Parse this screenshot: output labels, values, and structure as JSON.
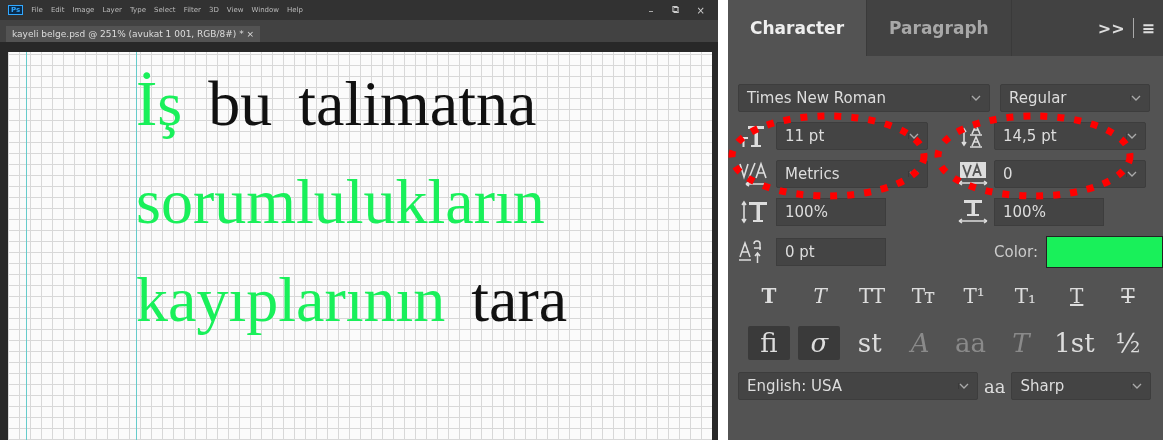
{
  "app": {
    "logo": "Ps",
    "menu": [
      "File",
      "Edit",
      "Image",
      "Layer",
      "Type",
      "Select",
      "Filter",
      "3D",
      "View",
      "Window",
      "Help"
    ],
    "window_controls": [
      "–",
      "⧉",
      "×"
    ]
  },
  "document_tab": {
    "title": "kayeli belge.psd @ 251% (avukat 1 001, RGB/8#) *",
    "close": "×",
    "selected": true
  },
  "canvas": {
    "lines": [
      [
        {
          "text": "İş",
          "highlighted": true
        },
        {
          "text": "bu",
          "highlighted": false
        },
        {
          "text": "talimatna",
          "highlighted": false
        }
      ],
      [
        {
          "text": "sorumlulukların",
          "highlighted": true
        }
      ],
      [
        {
          "text": "kayıplarının",
          "highlighted": true
        },
        {
          "text": "tara",
          "highlighted": false
        }
      ]
    ]
  },
  "character_panel": {
    "tabs": [
      {
        "label": "Character",
        "selected": true
      },
      {
        "label": "Paragraph",
        "selected": false
      }
    ],
    "overflow": ">>",
    "menu": "≡",
    "font_family": "Times New Roman",
    "font_style": "Regular",
    "font_size": "11 pt",
    "leading": "14,5 pt",
    "kerning": "Metrics",
    "tracking": "0",
    "vertical_scale": "100%",
    "horizontal_scale": "100%",
    "baseline_shift": "0 pt",
    "color_label": "Color:",
    "color": "#19f05a",
    "type_styles": [
      {
        "kind": "bold",
        "label": "T",
        "selected": false
      },
      {
        "kind": "italic",
        "label": "T",
        "selected": false
      },
      {
        "kind": "caps",
        "label": "TT",
        "selected": false
      },
      {
        "kind": "smallcaps",
        "label": "Tт",
        "selected": false
      },
      {
        "kind": "super",
        "label": "T¹",
        "selected": false
      },
      {
        "kind": "sub",
        "label": "T₁",
        "selected": false
      },
      {
        "kind": "underline",
        "label": "T",
        "selected": false
      },
      {
        "kind": "strike",
        "label": "T",
        "selected": false
      }
    ],
    "opentype_features": [
      {
        "kind": "plain",
        "label": "fi",
        "selected": true,
        "disabled": false
      },
      {
        "kind": "italic",
        "label": "σ",
        "selected": true,
        "disabled": false
      },
      {
        "kind": "plain",
        "label": "st",
        "selected": false,
        "disabled": false
      },
      {
        "kind": "italic",
        "label": "A",
        "selected": false,
        "disabled": true
      },
      {
        "kind": "plain",
        "label": "aa",
        "selected": false,
        "disabled": true
      },
      {
        "kind": "italic",
        "label": "T",
        "selected": false,
        "disabled": true
      },
      {
        "kind": "ordinal",
        "label": "1st",
        "selected": false,
        "disabled": false
      },
      {
        "kind": "plain",
        "label": "½",
        "selected": false,
        "disabled": false
      }
    ],
    "language": "English: USA",
    "antialias_icon": "aa",
    "antialias": "Sharp"
  }
}
